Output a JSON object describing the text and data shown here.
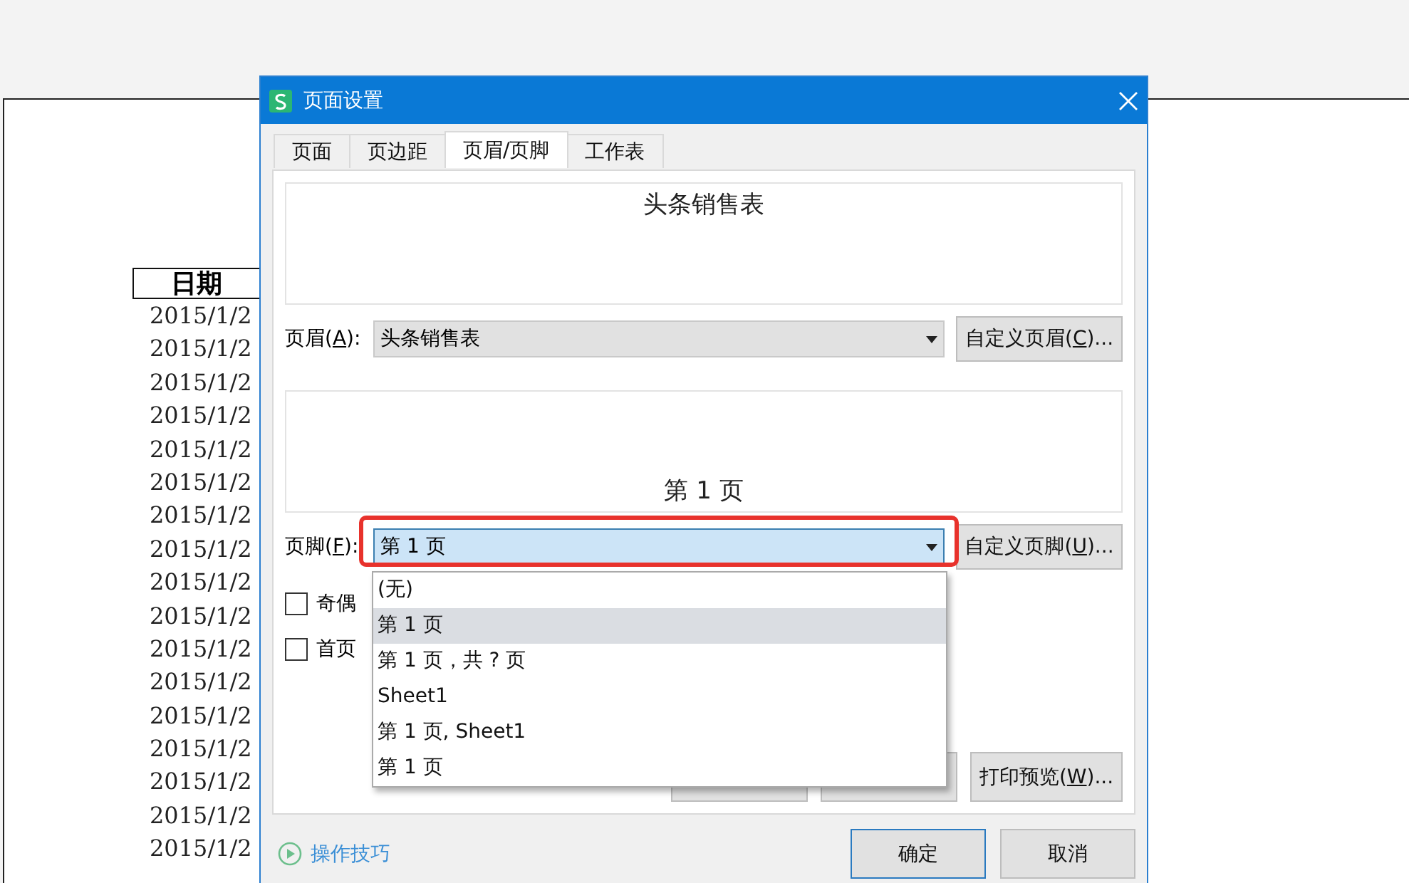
{
  "sheet": {
    "header": "日期",
    "dates": [
      "2015/1/2",
      "2015/1/2",
      "2015/1/2",
      "2015/1/2",
      "2015/1/2",
      "2015/1/2",
      "2015/1/2",
      "2015/1/2",
      "2015/1/2",
      "2015/1/2",
      "2015/1/2",
      "2015/1/2",
      "2015/1/2",
      "2015/1/2",
      "2015/1/2",
      "2015/1/2",
      "2015/1/2"
    ]
  },
  "dialog": {
    "title": "页面设置",
    "tabs": [
      {
        "label": "页面",
        "selected": false
      },
      {
        "label": "页边距",
        "selected": false
      },
      {
        "label": "页眉/页脚",
        "selected": true
      },
      {
        "label": "工作表",
        "selected": false
      }
    ],
    "header_preview": "头条销售表",
    "header_field": {
      "label": [
        "页眉(",
        "A",
        "):"
      ],
      "value": "头条销售表",
      "focused": false,
      "button": [
        "自定义页眉(",
        "C",
        ")..."
      ]
    },
    "footer_preview": "第 1 页",
    "footer_field": {
      "label": [
        "页脚(",
        "F",
        "):"
      ],
      "value": "第 1 页",
      "focused": true,
      "button": [
        "自定义页脚(",
        "U",
        ")..."
      ]
    },
    "footer_options": [
      {
        "label": "(无)",
        "selected": false
      },
      {
        "label": "第 1 页",
        "selected": true
      },
      {
        "label": "第 1 页，共 ? 页",
        "selected": false
      },
      {
        "label": "Sheet1",
        "selected": false
      },
      {
        "label": "第 1 页, Sheet1",
        "selected": false
      },
      {
        "label": "第 1 页",
        "selected": false
      }
    ],
    "checkboxes": [
      {
        "label": "奇偶",
        "checked": false
      },
      {
        "label": "首页",
        "checked": false
      }
    ],
    "print_preview": [
      "打印预览(",
      "W",
      ")..."
    ],
    "tips_link": "操作技巧",
    "ok": "确定",
    "cancel": "取消"
  }
}
